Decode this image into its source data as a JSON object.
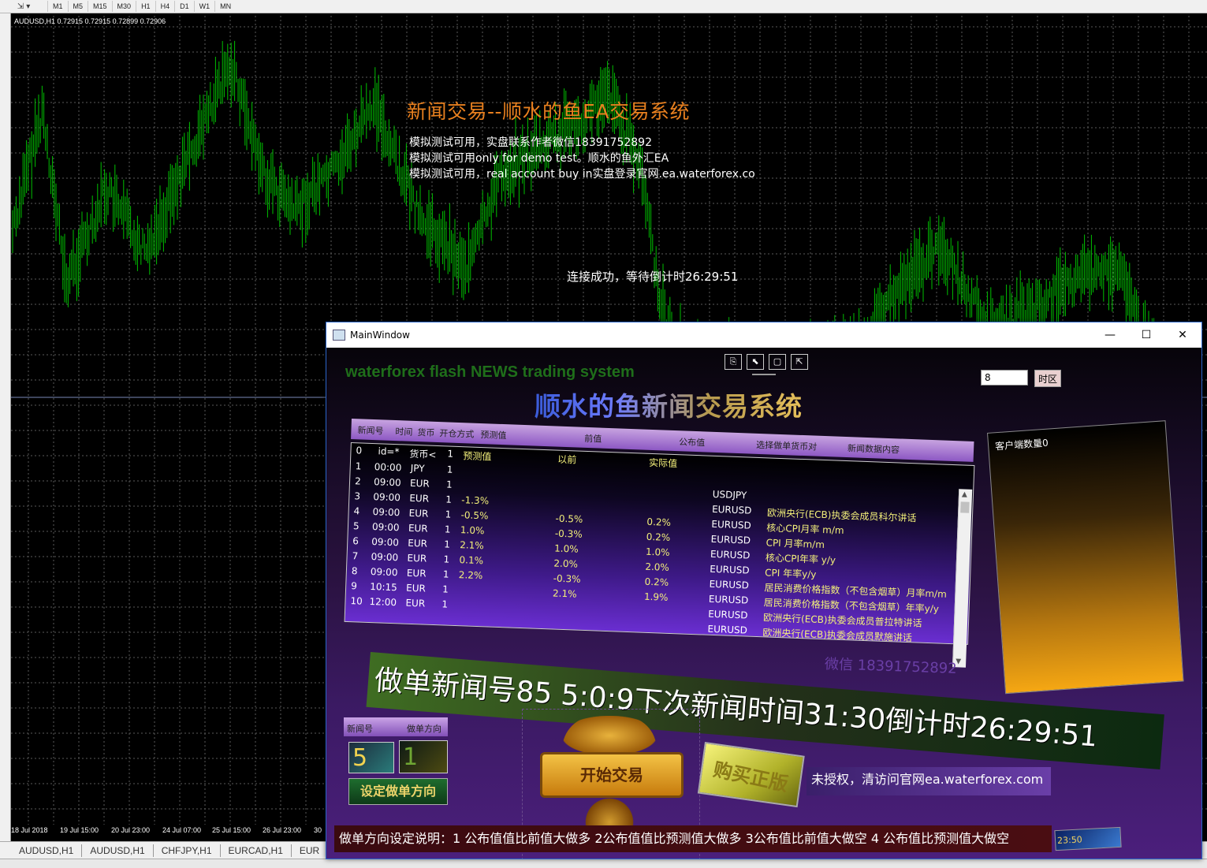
{
  "toolbar": {
    "tools_icon": "cursor-icon",
    "timeframes": [
      "M1",
      "M5",
      "M15",
      "M30",
      "H1",
      "H4",
      "D1",
      "W1",
      "MN"
    ]
  },
  "chart": {
    "header": "AUDUSD,H1  0.72915 0.72915 0.72899 0.72906",
    "ea_title": "新闻交易--顺水的鱼EA交易系统",
    "ea_lines": [
      "模拟测试可用，实盘联系作者微信18391752892",
      "模拟测试可用only for demo test。顺水的鱼外汇EA",
      "模拟测试可用，real account buy in实盘登录官网.ea.waterforex.co"
    ],
    "connect_status": "连接成功，等待倒计时26:29:51",
    "dates": [
      "18 Jul 2018",
      "19 Jul 15:00",
      "20 Jul 23:00",
      "24 Jul 07:00",
      "25 Jul 15:00",
      "26 Jul 23:00",
      "30"
    ],
    "candle_color": "#00c000",
    "grid_color": "#5a5a5a"
  },
  "tabs": [
    "AUDUSD,H1",
    "AUDUSD,H1",
    "CHFJPY,H1",
    "EURCAD,H1",
    "EUR"
  ],
  "mainwindow": {
    "title": "MainWindow",
    "controls": {
      "minimize": "—",
      "maximize": "☐",
      "close": "✕"
    },
    "toolbar_icons": [
      "⎘",
      "⬉",
      "▢",
      "⇱"
    ],
    "en_title": "waterforex flash NEWS trading system",
    "cn_title": "顺水的鱼新闻交易系统",
    "timezone_value": "8",
    "timezone_button": "时区",
    "news_header": [
      "新闻号",
      "时间",
      "货币",
      "开仓方式",
      "预测值",
      "前值",
      "公布值",
      "选择做单货币对",
      "新闻数据内容"
    ],
    "news_sub_header": {
      "id": "0",
      "idx": "id=*",
      "currency": "货币<",
      "flag": "1",
      "forecast": "预测值",
      "previous": "以前",
      "actual": "实际值"
    },
    "news_rows": [
      {
        "no": "1",
        "time": "00:00",
        "cur": "JPY",
        "mode": "1",
        "forecast": "",
        "previous": "",
        "actual": "",
        "pair": "",
        "content": ""
      },
      {
        "no": "2",
        "time": "09:00",
        "cur": "EUR",
        "mode": "1",
        "forecast": "",
        "previous": "",
        "actual": "",
        "pair": "USDJPY",
        "content": ""
      },
      {
        "no": "3",
        "time": "09:00",
        "cur": "EUR",
        "mode": "1",
        "forecast": "-1.3%",
        "previous": "",
        "actual": "",
        "pair": "EURUSD",
        "content": "欧洲央行(ECB)执委会成员科尔讲话"
      },
      {
        "no": "4",
        "time": "09:00",
        "cur": "EUR",
        "mode": "1",
        "forecast": "-0.5%",
        "previous": "-0.5%",
        "actual": "0.2%",
        "pair": "EURUSD",
        "content": "核心CPI月率 m/m"
      },
      {
        "no": "5",
        "time": "09:00",
        "cur": "EUR",
        "mode": "1",
        "forecast": "1.0%",
        "previous": "-0.3%",
        "actual": "0.2%",
        "pair": "EURUSD",
        "content": "CPI 月率m/m"
      },
      {
        "no": "6",
        "time": "09:00",
        "cur": "EUR",
        "mode": "1",
        "forecast": "2.1%",
        "previous": "1.0%",
        "actual": "1.0%",
        "pair": "EURUSD",
        "content": "核心CPI年率 y/y"
      },
      {
        "no": "7",
        "time": "09:00",
        "cur": "EUR",
        "mode": "1",
        "forecast": "0.1%",
        "previous": "2.0%",
        "actual": "2.0%",
        "pair": "EURUSD",
        "content": "CPI 年率y/y"
      },
      {
        "no": "8",
        "time": "09:00",
        "cur": "EUR",
        "mode": "1",
        "forecast": "2.2%",
        "previous": "-0.3%",
        "actual": "0.2%",
        "pair": "EURUSD",
        "content": "居民消费价格指数（不包含烟草）月率m/m"
      },
      {
        "no": "9",
        "time": "10:15",
        "cur": "EUR",
        "mode": "1",
        "forecast": "",
        "previous": "2.1%",
        "actual": "1.9%",
        "pair": "EURUSD",
        "content": "居民消费价格指数（不包含烟草）年率y/y"
      },
      {
        "no": "10",
        "time": "12:00",
        "cur": "EUR",
        "mode": "1",
        "forecast": "",
        "previous": "",
        "actual": "",
        "pair": "EURUSD",
        "content": "欧洲央行(ECB)执委会成员普拉特讲话"
      },
      {
        "no": "",
        "time": "",
        "cur": "",
        "mode": "",
        "forecast": "",
        "previous": "",
        "actual": "",
        "pair": "EURUSD",
        "content": "欧洲央行(ECB)执委会成员默施讲话"
      }
    ],
    "client_count": "客户端数量0",
    "wechat": "微信 18391752892",
    "banner": "做单新闻号85   5:0:9下次新闻时间31:30倒计时26:29:51",
    "ctl_header": {
      "news_no": "新闻号",
      "direction": "做单方向"
    },
    "news_no_value": "5",
    "direction_value": "1",
    "set_direction_button": "设定做单方向",
    "logo_text": "开始交易",
    "buy_button": "购买正版",
    "license_status": "未授权，清访问官网ea.waterforex.com",
    "instructions": "做单方向设定说明：1 公布值值比前值大做多  2公布值值比预测值大做多  3公布值比前值大做空 4 公布值比预测值大做空",
    "clock": "23:50"
  }
}
